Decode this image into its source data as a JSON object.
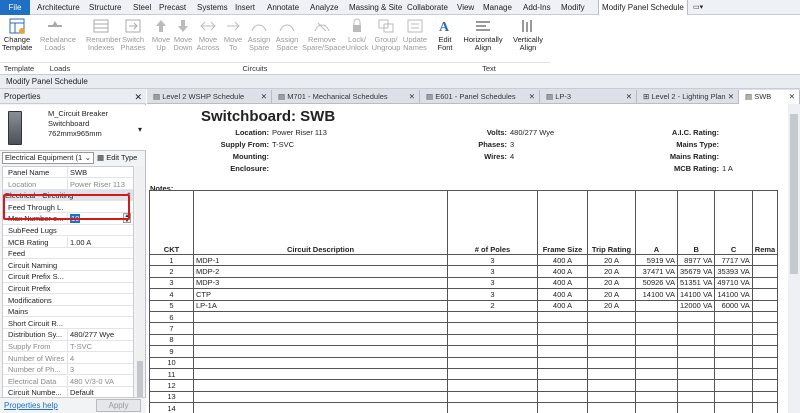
{
  "menu": [
    "File",
    "Architecture",
    "Structure",
    "Steel",
    "Precast",
    "Systems",
    "Insert",
    "Annotate",
    "Analyze",
    "Massing & Site",
    "Collaborate",
    "View",
    "Manage",
    "Add-Ins",
    "Modify",
    "Modify Panel Schedule"
  ],
  "ribbon": {
    "buttons": [
      {
        "label1": "Change",
        "label2": "Template"
      },
      {
        "label1": "Rebalance",
        "label2": "Loads"
      },
      {
        "label1": "Renumber",
        "label2": "Indexes"
      },
      {
        "label1": "Switch",
        "label2": "Phases"
      },
      {
        "label1": "Move",
        "label2": "Up"
      },
      {
        "label1": "Move",
        "label2": "Down"
      },
      {
        "label1": "Move",
        "label2": "Across"
      },
      {
        "label1": "Move",
        "label2": "To"
      },
      {
        "label1": "Assign",
        "label2": "Spare"
      },
      {
        "label1": "Assign",
        "label2": "Space"
      },
      {
        "label1": "Remove",
        "label2": "Spare/Space"
      },
      {
        "label1": "Lock/",
        "label2": "Unlock"
      },
      {
        "label1": "Group/",
        "label2": "Ungroup"
      },
      {
        "label1": "Update",
        "label2": "Names"
      },
      {
        "label1": "Edit",
        "label2": "Font"
      },
      {
        "label1": "Horizontally",
        "label2": "Align"
      },
      {
        "label1": "Vertically",
        "label2": "Align"
      }
    ],
    "groups": [
      "Template",
      "Loads",
      "Circuits",
      "Text"
    ]
  },
  "context_bar": "Modify Panel Schedule",
  "properties": {
    "title": "Properties",
    "type_name1": "M_Circuit Breaker",
    "type_name2": "Switchboard",
    "type_name3": "762mmx965mm",
    "selector": "Electrical Equipment (1",
    "edit_type": "Edit Type",
    "rows": [
      {
        "k": "Panel Name",
        "v": "SWB"
      },
      {
        "k": "Location",
        "v": "Power Riser 113"
      },
      {
        "k": "Electrical - Circuiting",
        "v": ""
      },
      {
        "k": "Feed Through L...",
        "v": ""
      },
      {
        "k": "Max Number o...",
        "v": "10"
      },
      {
        "k": "SubFeed Lugs",
        "v": ""
      },
      {
        "k": "MCB Rating",
        "v": "1.00 A"
      },
      {
        "k": "Feed",
        "v": ""
      },
      {
        "k": "Circuit Naming",
        "v": ""
      },
      {
        "k": "Circuit Prefix S...",
        "v": ""
      },
      {
        "k": "Circuit Prefix",
        "v": ""
      },
      {
        "k": "Modifications",
        "v": ""
      },
      {
        "k": "Mains",
        "v": ""
      },
      {
        "k": "Short Circuit R...",
        "v": ""
      },
      {
        "k": "Distribution Sy...",
        "v": "480/277 Wye"
      },
      {
        "k": "Supply From",
        "v": "T-SVC"
      },
      {
        "k": "Number of Wires",
        "v": "4"
      },
      {
        "k": "Number of Ph...",
        "v": "3"
      },
      {
        "k": "Electrical Data",
        "v": "480 V/3-0 VA"
      },
      {
        "k": "Circuit Numbe...",
        "v": "Default"
      }
    ],
    "help": "Properties help",
    "apply": "Apply"
  },
  "tabs": [
    "Level 2 WSHP Schedule",
    "M701 - Mechanical Schedules",
    "E601 - Panel Schedules",
    "LP-3",
    "Level 2 - Lighting Plan",
    "SWB"
  ],
  "schedule": {
    "title": "Switchboard: SWB",
    "location_label": "Location:",
    "location": "Power Riser 113",
    "supply_label": "Supply From:",
    "supply": "T-SVC",
    "mounting_label": "Mounting:",
    "enclosure_label": "Enclosure:",
    "volts_label": "Volts:",
    "volts": "480/277 Wye",
    "phases_label": "Phases:",
    "phases": "3",
    "wires_label": "Wires:",
    "wires": "4",
    "aic_label": "A.I.C. Rating:",
    "mainstype_label": "Mains Type:",
    "mainsrating_label": "Mains Rating:",
    "mcb_label": "MCB Rating:",
    "mcb": "1 A",
    "notes_label": "Notes:",
    "headers": [
      "CKT",
      "Circuit Description",
      "# of Poles",
      "Frame Size",
      "Trip Rating",
      "A",
      "B",
      "C",
      "Rema"
    ],
    "rows": [
      [
        "1",
        "MDP-1",
        "3",
        "400 A",
        "20 A",
        "5919 VA",
        "8977 VA",
        "7717 VA",
        ""
      ],
      [
        "2",
        "MDP-2",
        "3",
        "400 A",
        "20 A",
        "37471 VA",
        "35679 VA",
        "35393 VA",
        ""
      ],
      [
        "3",
        "MDP-3",
        "3",
        "400 A",
        "20 A",
        "50926 VA",
        "51351 VA",
        "49710 VA",
        ""
      ],
      [
        "4",
        "CTP",
        "3",
        "400 A",
        "20 A",
        "14100 VA",
        "14100 VA",
        "14100 VA",
        ""
      ],
      [
        "5",
        "LP-1A",
        "2",
        "400 A",
        "20 A",
        "",
        "12000 VA",
        "6000 VA",
        ""
      ],
      [
        "6",
        "",
        "",
        "",
        "",
        "",
        "",
        "",
        ""
      ],
      [
        "7",
        "",
        "",
        "",
        "",
        "",
        "",
        "",
        ""
      ],
      [
        "8",
        "",
        "",
        "",
        "",
        "",
        "",
        "",
        ""
      ],
      [
        "9",
        "",
        "",
        "",
        "",
        "",
        "",
        "",
        ""
      ],
      [
        "10",
        "",
        "",
        "",
        "",
        "",
        "",
        "",
        ""
      ],
      [
        "11",
        "",
        "",
        "",
        "",
        "",
        "",
        "",
        ""
      ],
      [
        "12",
        "",
        "",
        "",
        "",
        "",
        "",
        "",
        ""
      ],
      [
        "13",
        "",
        "",
        "",
        "",
        "",
        "",
        "",
        ""
      ],
      [
        "14",
        "",
        "",
        "",
        "",
        "",
        "",
        "",
        ""
      ]
    ]
  }
}
